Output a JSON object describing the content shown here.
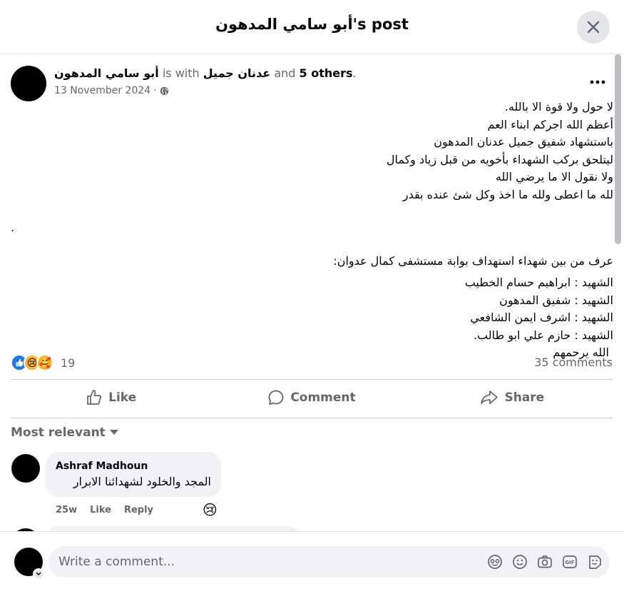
{
  "header": {
    "title": "أبو سامي المدهون's post"
  },
  "post": {
    "author": "أبو سامي المدهون",
    "is_with": "is with",
    "tagged": "عدنان جميل",
    "and": "and",
    "others": "5 others",
    "date": "13 November 2024",
    "privacy_icon": "globe-icon",
    "lines": [
      "لا حول ولا قوة الا بالله.",
      "أعظم الله اجركم ابناء العم",
      "باستشهاد شفيق جميل عدنان المدهون",
      "ليتلحق بركب الشهداء بأخويه من قبل زياد وكمال",
      "ولا نقول الا ما يرضي الله",
      "لله ما اعطى ولله ما اخذ وكل شئ عنده بقدر",
      ".",
      "عرف من بين شهداء استهداف بوابة مستشفى كمال عدوان:",
      "الشهيد : ابراهيم حسام الخطيب",
      "الشهيد : شفيق المدهون",
      "الشهيد : اشرف ايمن الشافعي",
      "الشهيد : حازم علي ابو طالب.",
      "الله يرحمهم"
    ]
  },
  "stats": {
    "reaction_count": "19",
    "comments": "35 comments"
  },
  "actions": {
    "like": "Like",
    "comment": "Comment",
    "share": "Share"
  },
  "sort": {
    "label": "Most relevant"
  },
  "comments": [
    {
      "author": "Ashraf Madhoun",
      "text": "المجد والخلود لشهدائنا الابرار",
      "time": "25w",
      "like": "Like",
      "reply": "Reply",
      "reaction": "😢"
    }
  ],
  "composer": {
    "placeholder": "Write a comment..."
  },
  "colors": {
    "accent": "#1877f2",
    "muted": "#65676b",
    "bubble": "#f0f2f5"
  }
}
